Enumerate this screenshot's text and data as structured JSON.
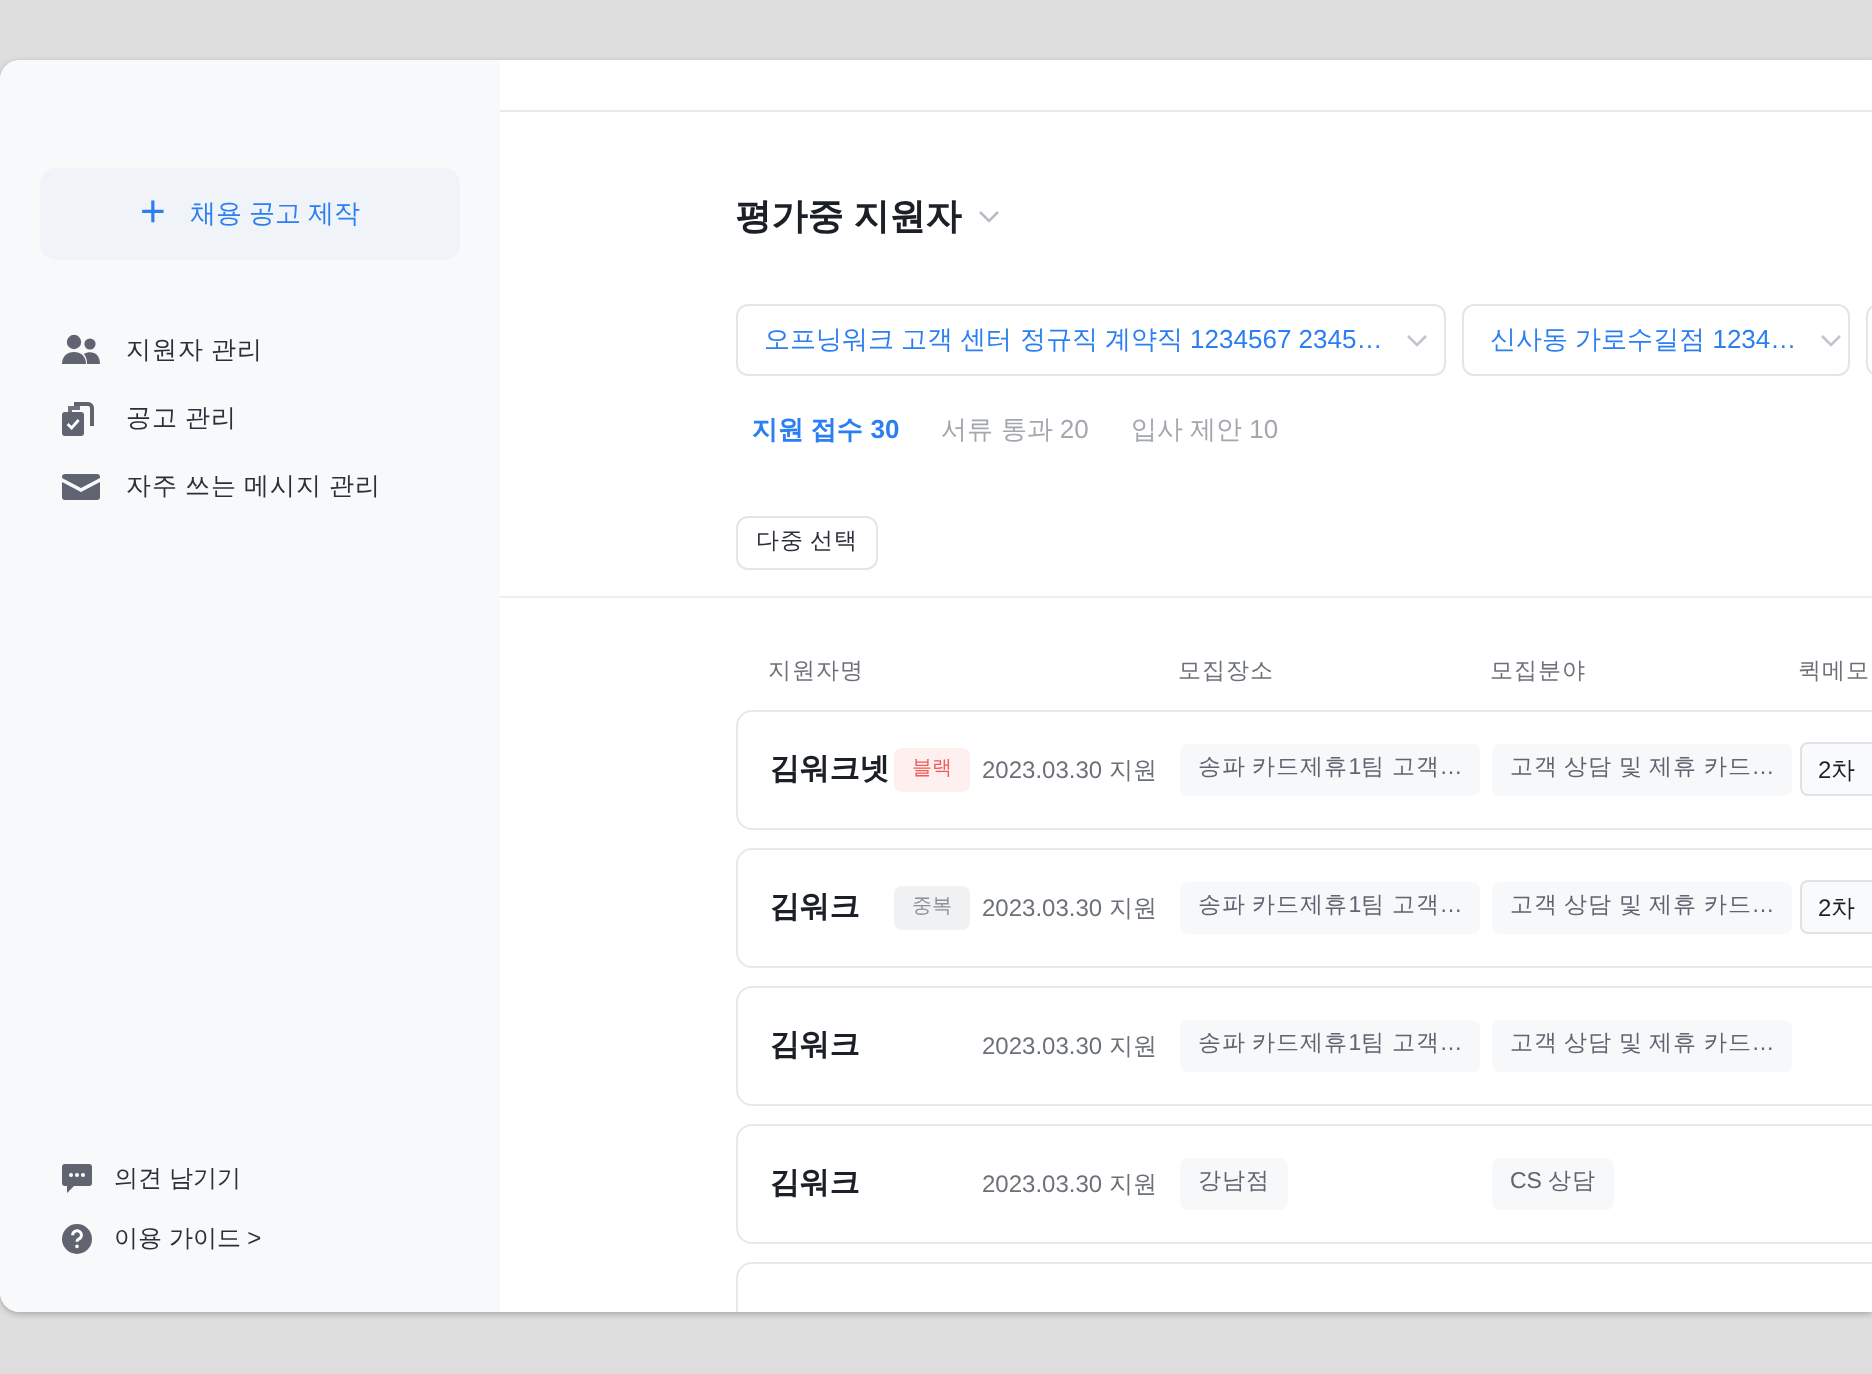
{
  "sidebar": {
    "create_button": {
      "icon": "+",
      "label": "채용 공고 제작"
    },
    "items": [
      {
        "kind": "people",
        "label": "지원자 관리"
      },
      {
        "kind": "document",
        "label": "공고 관리"
      },
      {
        "kind": "mail",
        "label": "자주 쓰는 메시지 관리"
      }
    ],
    "footer_items": [
      {
        "kind": "chat",
        "label": "의견 남기기"
      },
      {
        "kind": "help",
        "label": "이용 가이드 >"
      }
    ]
  },
  "main": {
    "title": "평가중 지원자",
    "filters": [
      {
        "kind": "select",
        "value": "오프닝워크 고객 센터 정규직 계약직 1234567 2345…"
      },
      {
        "kind": "select",
        "value": "신사동 가로수길점 1234…"
      },
      {
        "kind": "clipped"
      }
    ],
    "tabs": [
      {
        "label": "지원 접수 30",
        "selected": true
      },
      {
        "label": "서류 통과 20",
        "selected": false
      },
      {
        "label": "입사 제안 10",
        "selected": false
      }
    ],
    "multi_select_button": "다중 선택",
    "table": {
      "columns": [
        "지원자명",
        "모집장소",
        "모집분야",
        "퀵메모"
      ],
      "rows": [
        {
          "name": "김워크넷",
          "badge": {
            "label": "블랙",
            "kind": "danger"
          },
          "date": "2023.03.30 지원",
          "place": "송파 카드제휴1팀 고객…",
          "field": "고객 상담 및 제휴 카드…",
          "memo": "2차"
        },
        {
          "name": "김워크",
          "badge": {
            "label": "중복",
            "kind": "neutral"
          },
          "date": "2023.03.30 지원",
          "place": "송파 카드제휴1팀 고객…",
          "field": "고객 상담 및 제휴 카드…",
          "memo": "2차"
        },
        {
          "name": "김워크",
          "date": "2023.03.30 지원",
          "place": "송파 카드제휴1팀 고객…",
          "field": "고객 상담 및 제휴 카드…"
        },
        {
          "name": "김워크",
          "date": "2023.03.30 지원",
          "place": "강남점",
          "field": "CS 상담"
        },
        {
          "kind": "clipped"
        }
      ]
    }
  }
}
